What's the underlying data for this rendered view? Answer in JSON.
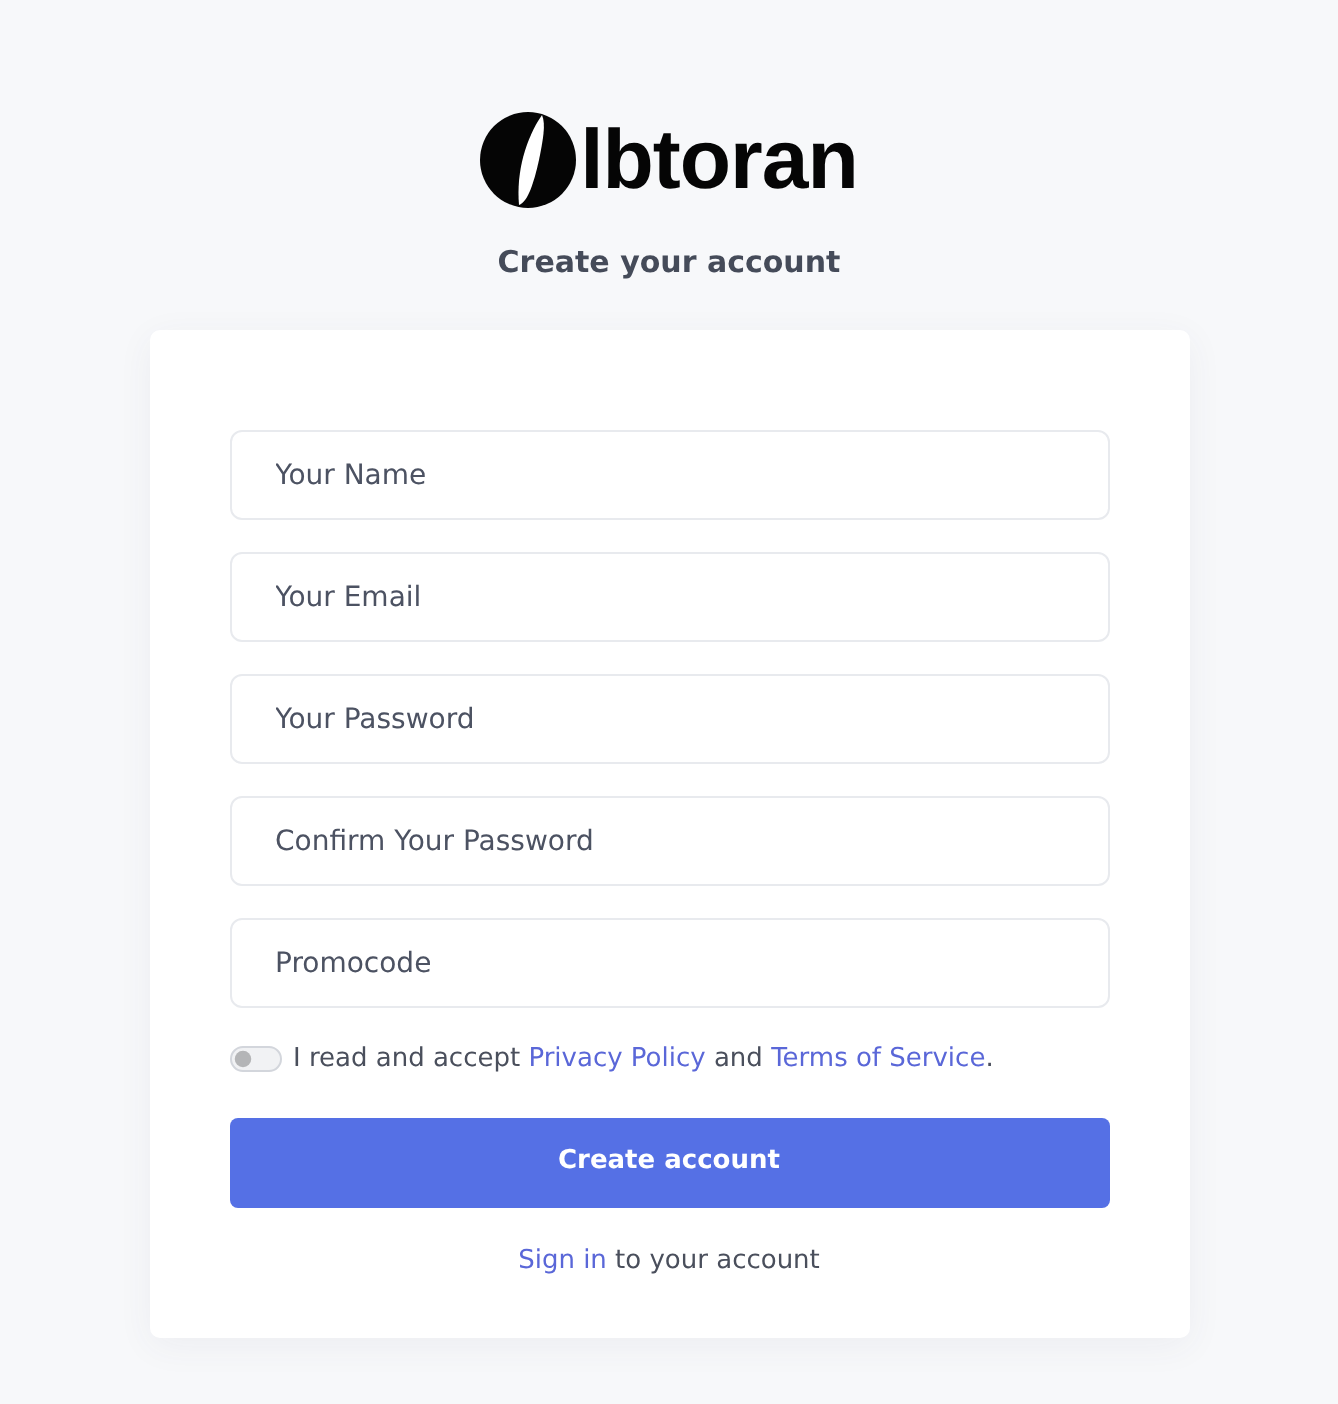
{
  "logo": {
    "text": "lbtoran"
  },
  "subtitle": "Create your account",
  "form": {
    "fields": [
      {
        "placeholder": "Your Name"
      },
      {
        "placeholder": "Your Email"
      },
      {
        "placeholder": "Your Password"
      },
      {
        "placeholder": "Confirm Your Password"
      },
      {
        "placeholder": "Promocode"
      }
    ],
    "agreement": {
      "checked": false,
      "segments": [
        {
          "kind": "text",
          "text": "I read and accept "
        },
        {
          "kind": "link",
          "text": "Privacy Policy"
        },
        {
          "kind": "text",
          "text": " and "
        },
        {
          "kind": "link",
          "text": "Terms of Service"
        },
        {
          "kind": "text",
          "text": "."
        }
      ]
    },
    "submit": "Create account",
    "footer": {
      "segments": [
        {
          "kind": "link",
          "text": "Sign in"
        },
        {
          "kind": "text",
          "text": " to your account"
        }
      ]
    }
  }
}
